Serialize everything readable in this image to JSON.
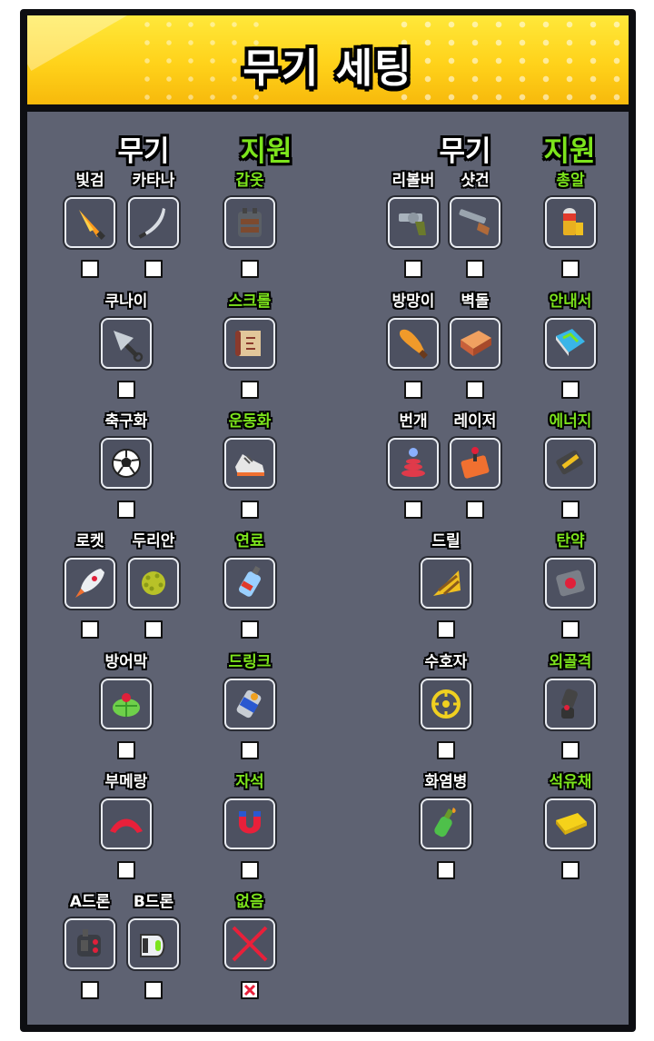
{
  "header": {
    "title": "무기 세팅"
  },
  "columns": {
    "left_weapon": "무기",
    "left_support": "지원",
    "right_weapon": "무기",
    "right_support": "지원"
  },
  "colors": {
    "support_label": "#7ce41c",
    "header_yellow": "#ffd21a",
    "panel": "#5e6272"
  },
  "items": [
    {
      "label": "빛검",
      "icon": "light-sword-icon",
      "type": "weapon",
      "checked": false
    },
    {
      "label": "카타나",
      "icon": "katana-icon",
      "type": "weapon",
      "checked": false
    },
    {
      "label": "갑옷",
      "icon": "armor-vest-icon",
      "type": "support",
      "checked": false
    },
    {
      "label": "리볼버",
      "icon": "revolver-icon",
      "type": "weapon",
      "checked": false
    },
    {
      "label": "샷건",
      "icon": "shotgun-icon",
      "type": "weapon",
      "checked": false
    },
    {
      "label": "총알",
      "icon": "bullet-icon",
      "type": "support",
      "checked": false
    },
    {
      "label": "쿠나이",
      "icon": "kunai-icon",
      "type": "weapon",
      "checked": false
    },
    {
      "label": "스크롤",
      "icon": "scroll-icon",
      "type": "support",
      "checked": false
    },
    {
      "label": "방망이",
      "icon": "bat-icon",
      "type": "weapon",
      "checked": false
    },
    {
      "label": "벽돌",
      "icon": "brick-icon",
      "type": "weapon",
      "checked": false
    },
    {
      "label": "안내서",
      "icon": "guidebook-icon",
      "type": "support",
      "checked": false
    },
    {
      "label": "축구화",
      "icon": "soccer-ball-icon",
      "type": "weapon",
      "checked": false
    },
    {
      "label": "운동화",
      "icon": "sneaker-icon",
      "type": "support",
      "checked": false
    },
    {
      "label": "번개",
      "icon": "lightning-coil-icon",
      "type": "weapon",
      "checked": false
    },
    {
      "label": "레이저",
      "icon": "laser-joystick-icon",
      "type": "weapon",
      "checked": false
    },
    {
      "label": "에너지",
      "icon": "energy-cell-icon",
      "type": "support",
      "checked": false
    },
    {
      "label": "로켓",
      "icon": "rocket-icon",
      "type": "weapon",
      "checked": false
    },
    {
      "label": "두리안",
      "icon": "durian-icon",
      "type": "weapon",
      "checked": false
    },
    {
      "label": "연료",
      "icon": "fuel-bottle-icon",
      "type": "support",
      "checked": false
    },
    {
      "label": "드릴",
      "icon": "drill-icon",
      "type": "weapon",
      "checked": false
    },
    {
      "label": "탄약",
      "icon": "ammo-icon",
      "type": "support",
      "checked": false
    },
    {
      "label": "방어막",
      "icon": "shield-dome-icon",
      "type": "weapon",
      "checked": false
    },
    {
      "label": "드링크",
      "icon": "drink-can-icon",
      "type": "support",
      "checked": false
    },
    {
      "label": "수호자",
      "icon": "guardian-icon",
      "type": "weapon",
      "checked": false
    },
    {
      "label": "외골격",
      "icon": "exoskeleton-icon",
      "type": "support",
      "checked": false
    },
    {
      "label": "부메랑",
      "icon": "boomerang-icon",
      "type": "weapon",
      "checked": false
    },
    {
      "label": "자석",
      "icon": "magnet-icon",
      "type": "support",
      "checked": false
    },
    {
      "label": "화염병",
      "icon": "molotov-icon",
      "type": "weapon",
      "checked": false
    },
    {
      "label": "석유채",
      "icon": "oil-bar-icon",
      "type": "support",
      "checked": false
    },
    {
      "label": "A드론",
      "icon": "drone-a-icon",
      "type": "weapon",
      "checked": false
    },
    {
      "label": "B드론",
      "icon": "drone-b-icon",
      "type": "weapon",
      "checked": false
    },
    {
      "label": "없음",
      "icon": "none-x-icon",
      "type": "support",
      "checked": true
    }
  ]
}
